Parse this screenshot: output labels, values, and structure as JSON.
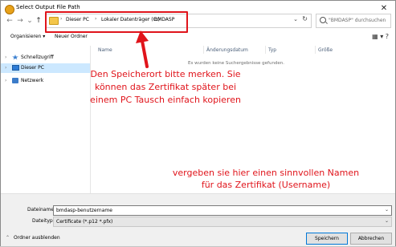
{
  "window": {
    "title": "Select Output File Path",
    "close_glyph": "✕",
    "app_icon": "app-circle-icon"
  },
  "nav": {
    "back": "←",
    "forward": "→",
    "recent": "⌄",
    "up": "↑"
  },
  "address": {
    "crumbs": [
      "Dieser PC",
      "Lokaler Datenträger (C:)",
      "BMDASP"
    ],
    "separator": "›",
    "dropdown_glyph": "⌄",
    "refresh_glyph": "↻"
  },
  "search": {
    "placeholder": "\"BMDASP\" durchsuchen"
  },
  "toolbar": {
    "organize": "Organisieren ▾",
    "new_folder": "Neuer Ordner",
    "view_glyphs": "▦ ▾  ?"
  },
  "sidebar": {
    "items": [
      {
        "label": "Schnellzugriff",
        "icon": "star-icon"
      },
      {
        "label": "Dieser PC",
        "icon": "computer-icon"
      },
      {
        "label": "Netzwerk",
        "icon": "network-icon"
      }
    ],
    "expand_glyph": "›"
  },
  "columns": [
    "Name",
    "Änderungsdatum",
    "Typ",
    "Größe"
  ],
  "empty_message": "Es wurden keine Suchergebnisse gefunden.",
  "annotations": {
    "storage_note": "Den Speicherort bitte merken. Sie können das Zertifikat später bei einem PC Tausch einfach kopieren",
    "name_note": "vergeben sie hier einen sinnvollen Namen für das Zertifikat (Username)",
    "accent_color": "#e0141b"
  },
  "form": {
    "filename_label": "Dateiname:",
    "filename_value": "bmdasp-benutzername",
    "filetype_label": "Dateityp:",
    "filetype_value": "Certificate (*.p12 *.pfx)",
    "dropdown_glyph": "⌄"
  },
  "footer": {
    "hide_folders": "Ordner ausblenden",
    "chevron": "⌃",
    "save": "Speichern",
    "cancel": "Abbrechen"
  }
}
